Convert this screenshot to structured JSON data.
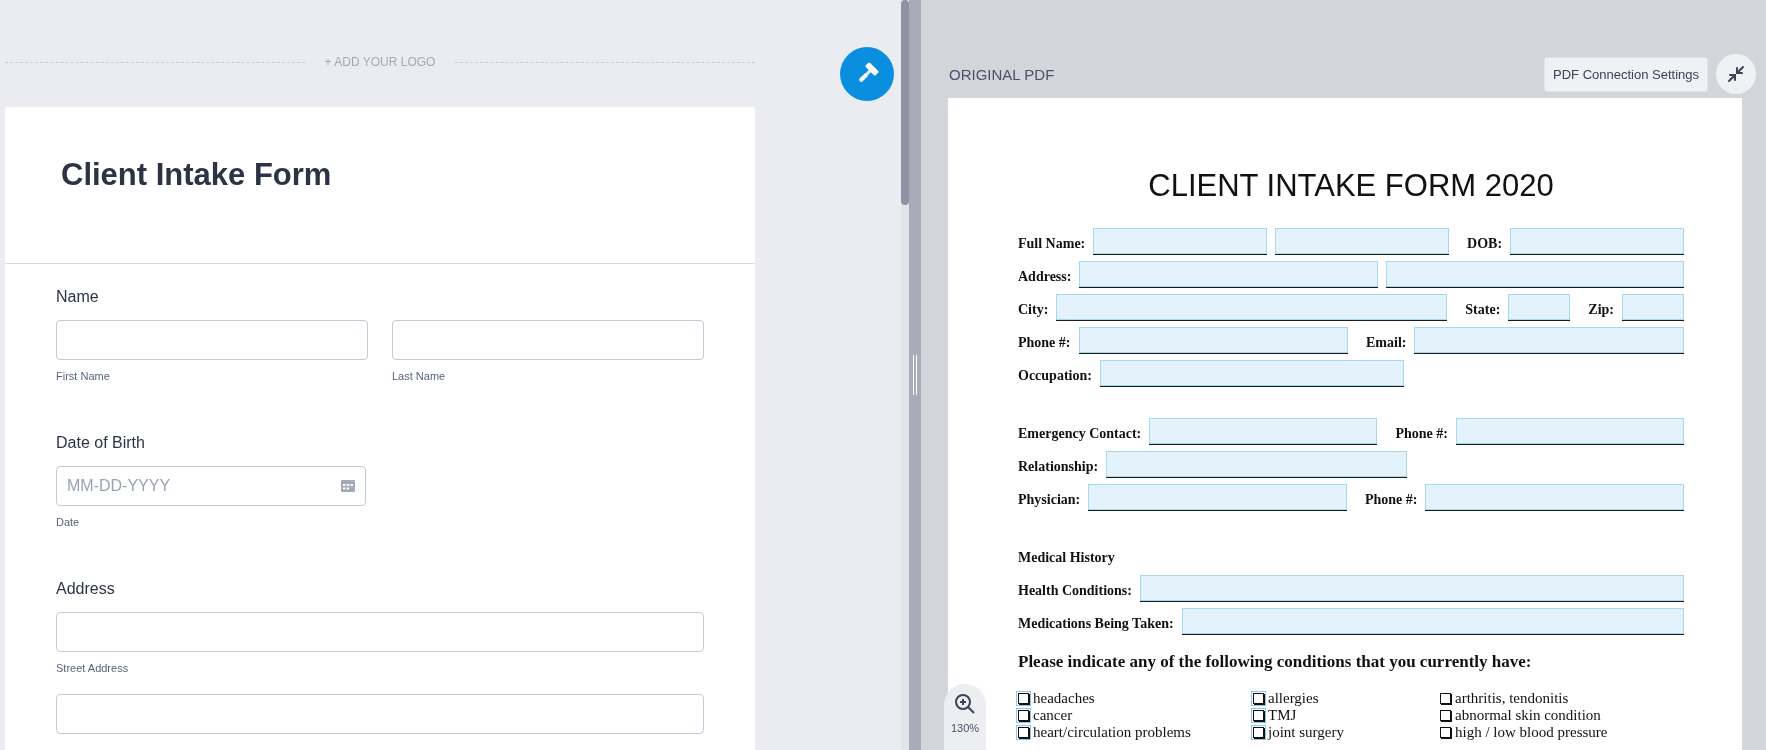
{
  "logo_placeholder": "+ ADD YOUR LOGO",
  "form": {
    "title": "Client Intake Form",
    "fields": [
      {
        "label": "Name",
        "kind": "pair",
        "inputs": [
          {
            "kind": "text",
            "sublabel": "First Name"
          },
          {
            "kind": "text",
            "sublabel": "Last Name"
          }
        ]
      },
      {
        "label": "Date of Birth",
        "kind": "date",
        "inputs": [
          {
            "kind": "date",
            "placeholder": "MM-DD-YYYY",
            "sublabel": "Date"
          }
        ]
      },
      {
        "label": "Address",
        "kind": "wide",
        "inputs": [
          {
            "kind": "text",
            "sublabel": "Street Address"
          },
          {
            "kind": "text"
          }
        ]
      }
    ]
  },
  "pdf_panel": {
    "heading": "ORIGINAL PDF",
    "settings_button": "PDF Connection Settings",
    "zoom_level": "130%",
    "page": {
      "title": "CLIENT INTAKE FORM 2020",
      "groups": [
        {
          "rows": [
            {
              "items": [
                {
                  "kind": "label",
                  "text": "Full Name:"
                },
                {
                  "kind": "field"
                },
                {
                  "kind": "field"
                },
                {
                  "kind": "label",
                  "text": "DOB:"
                },
                {
                  "kind": "field"
                }
              ]
            },
            {
              "items": [
                {
                  "kind": "label",
                  "text": "Address:"
                },
                {
                  "kind": "field"
                },
                {
                  "kind": "field"
                }
              ]
            },
            {
              "items": [
                {
                  "kind": "label",
                  "text": "City:"
                },
                {
                  "kind": "field"
                },
                {
                  "kind": "label",
                  "text": "State:"
                },
                {
                  "kind": "short-field"
                },
                {
                  "kind": "label",
                  "text": "Zip:"
                },
                {
                  "kind": "short-field"
                }
              ]
            },
            {
              "items": [
                {
                  "kind": "label",
                  "text": "Phone #:"
                },
                {
                  "kind": "field"
                },
                {
                  "kind": "label",
                  "text": "Email:"
                },
                {
                  "kind": "field"
                }
              ]
            },
            {
              "items": [
                {
                  "kind": "label",
                  "text": "Occupation:"
                },
                {
                  "kind": "field"
                },
                {
                  "kind": "spacer"
                }
              ]
            }
          ]
        },
        {
          "rows": [
            {
              "items": [
                {
                  "kind": "label",
                  "text": "Emergency Contact:"
                },
                {
                  "kind": "field"
                },
                {
                  "kind": "label",
                  "text": "Phone #:"
                },
                {
                  "kind": "field"
                }
              ]
            },
            {
              "items": [
                {
                  "kind": "label",
                  "text": "Relationship:"
                },
                {
                  "kind": "field"
                },
                {
                  "kind": "spacer"
                }
              ]
            },
            {
              "items": [
                {
                  "kind": "label",
                  "text": "Physician:"
                },
                {
                  "kind": "field"
                },
                {
                  "kind": "label",
                  "text": "Phone #:"
                },
                {
                  "kind": "field"
                }
              ]
            }
          ]
        },
        {
          "rows": [
            {
              "items": [
                {
                  "kind": "label",
                  "text": "Medical History"
                }
              ]
            },
            {
              "items": [
                {
                  "kind": "label",
                  "text": "Health Conditions:"
                },
                {
                  "kind": "field"
                }
              ]
            },
            {
              "items": [
                {
                  "kind": "label",
                  "text": "Medications Being Taken:"
                },
                {
                  "kind": "field"
                }
              ]
            }
          ]
        }
      ],
      "prompt": "Please indicate any of the following conditions that you currently have:",
      "conditions": [
        {
          "label": "headaches",
          "kind": "field-checkbox",
          "checked": false
        },
        {
          "label": "allergies",
          "kind": "field-checkbox",
          "checked": false
        },
        {
          "label": "arthritis, tendonitis",
          "kind": "checkbox",
          "checked": false
        },
        {
          "label": "cancer",
          "kind": "field-checkbox",
          "checked": false
        },
        {
          "label": "TMJ",
          "kind": "field-checkbox",
          "checked": false
        },
        {
          "label": "abnormal skin condition",
          "kind": "checkbox",
          "checked": false
        },
        {
          "label": "heart/circulation problems",
          "kind": "field-checkbox",
          "checked": false
        },
        {
          "label": "joint surgery",
          "kind": "field-checkbox",
          "checked": false
        },
        {
          "label": "high / low blood pressure",
          "kind": "checkbox",
          "checked": false
        }
      ]
    }
  }
}
